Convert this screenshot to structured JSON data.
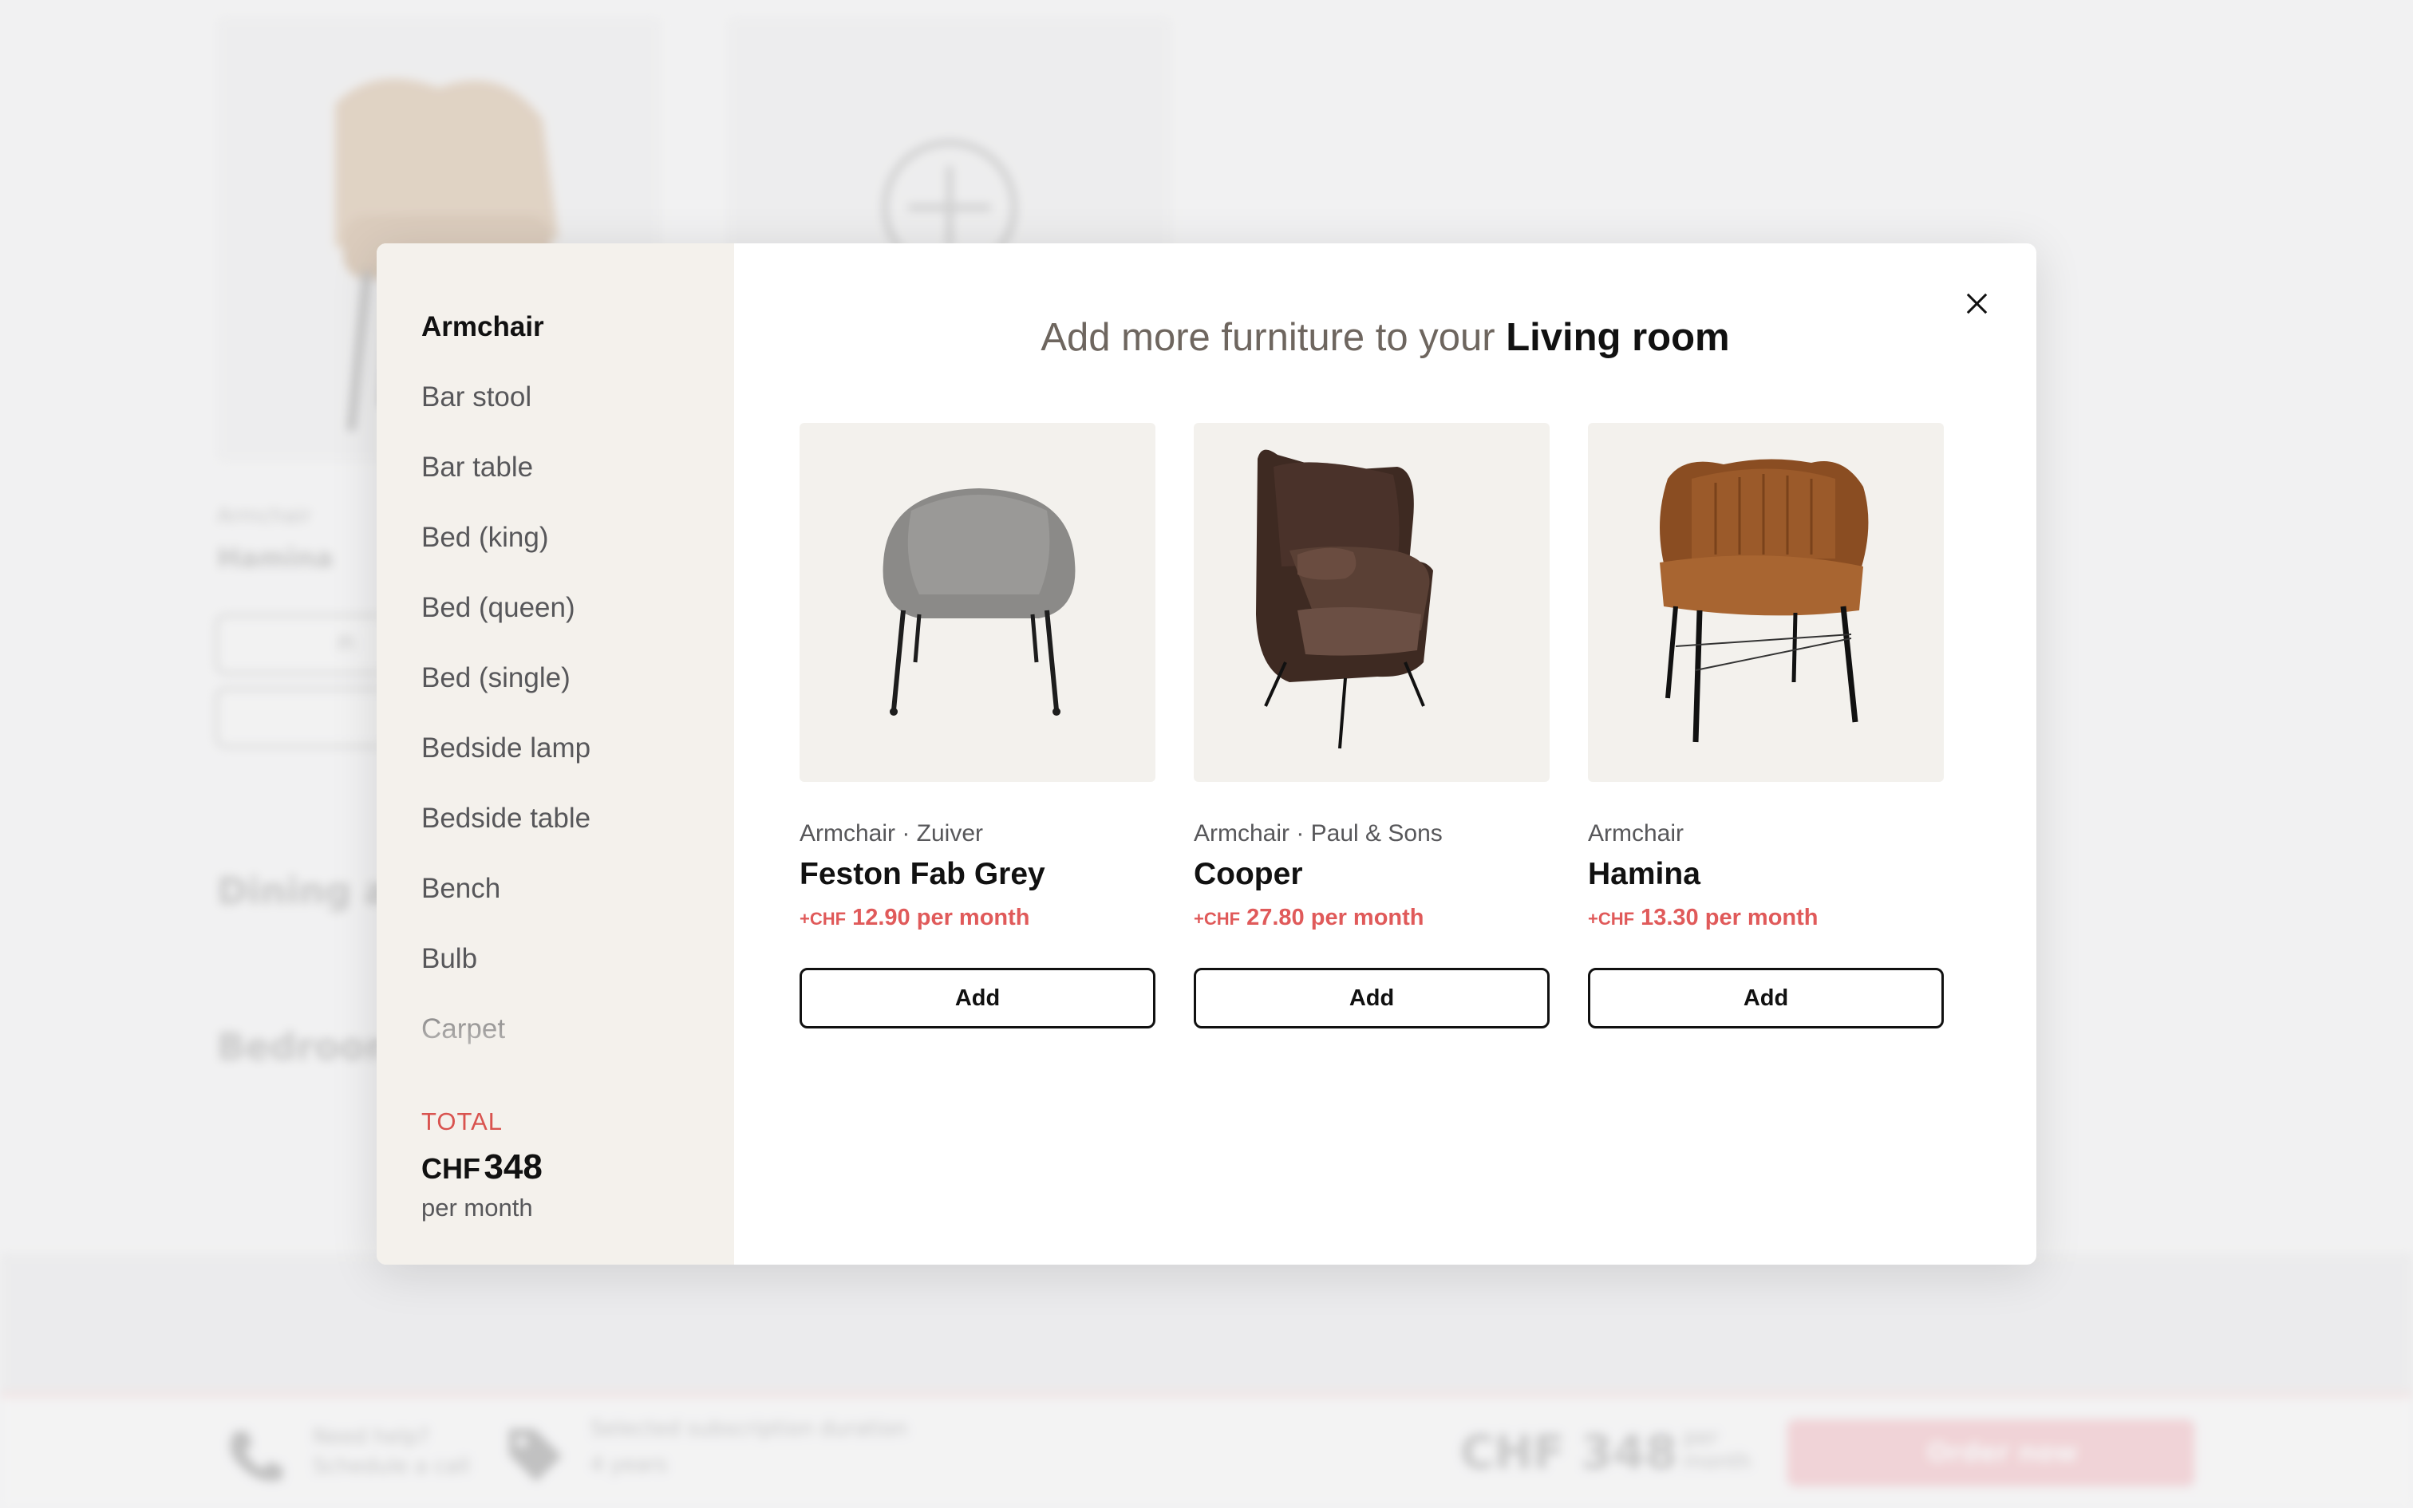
{
  "background": {
    "card_category": "Armchair",
    "card_name": "Hamina",
    "card_button_label": "Pi",
    "section_dining": "Dining ar",
    "section_bedroom": "Bedroom",
    "footer": {
      "help_title": "Need help?",
      "help_link": "Schedule a call",
      "duration_title": "Selected subscription duration",
      "duration_value": "4 years",
      "price": "CHF 348",
      "price_period": "per month",
      "order_label": "Order now"
    }
  },
  "modal": {
    "headline_prefix": "Add more furniture to your ",
    "headline_room": "Living room",
    "categories": [
      {
        "label": "Armchair",
        "active": true
      },
      {
        "label": "Bar stool",
        "active": false
      },
      {
        "label": "Bar table",
        "active": false
      },
      {
        "label": "Bed (king)",
        "active": false
      },
      {
        "label": "Bed (queen)",
        "active": false
      },
      {
        "label": "Bed (single)",
        "active": false
      },
      {
        "label": "Bedside lamp",
        "active": false
      },
      {
        "label": "Bedside table",
        "active": false
      },
      {
        "label": "Bench",
        "active": false
      },
      {
        "label": "Bulb",
        "active": false
      },
      {
        "label": "Carpet",
        "active": false
      }
    ],
    "total": {
      "label": "TOTAL",
      "currency": "CHF",
      "amount": "348",
      "period": "per month"
    },
    "products": [
      {
        "meta": "Armchair · Zuiver",
        "name": "Feston Fab Grey",
        "price_prefix": "+CHF",
        "price": " 12.90 per month",
        "button": "Add"
      },
      {
        "meta": "Armchair · Paul & Sons",
        "name": "Cooper",
        "price_prefix": "+CHF",
        "price": " 27.80 per month",
        "button": "Add"
      },
      {
        "meta": "Armchair",
        "name": "Hamina",
        "price_prefix": "+CHF",
        "price": " 13.30 per month",
        "button": "Add"
      }
    ],
    "colors": {
      "accent": "#e05a5a",
      "sidebar_bg": "#f4f1ec",
      "thumb_bg": "#f3f1ed"
    }
  }
}
